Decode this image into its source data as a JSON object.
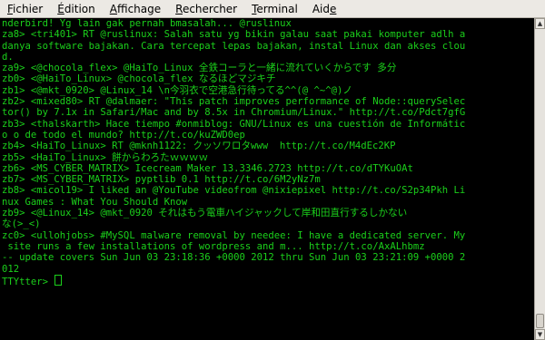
{
  "menu": [
    {
      "mn": "F",
      "rest": "ichier"
    },
    {
      "mn": "É",
      "rest": "dition"
    },
    {
      "mn": "A",
      "rest": "ffichage"
    },
    {
      "mn": "R",
      "rest": "echercher"
    },
    {
      "mn": "T",
      "rest": "erminal"
    },
    {
      "mn": "",
      "pre": "Aid",
      "mn2": "e"
    }
  ],
  "terminal": {
    "lines": [
      "nderbird! Yg lain gak pernah bmasalah... @ruslinux",
      "za8> <tri401> RT @ruslinux: Salah satu yg bikin galau saat pakai komputer adlh a",
      "danya software bajakan. Cara tercepat lepas bajakan, instal Linux dan akses clou",
      "d.",
      "za9> <@chocola_flex> @HaiTo_Linux 全鉄コーラと一緒に流れていくからです 多分",
      "zb0> <@HaiTo_Linux> @chocola_flex なるほどマジキチ",
      "zb1> <@mkt_0920> @Linux_14 \\n今羽衣で空港急行待ってる^^(@ ^~^@)ノ",
      "zb2> <mixed80> RT @dalmaer: \"This patch improves performance of Node::querySelec",
      "tor() by 7.1x in Safari/Mac and by 8.5x in Chromium/Linux.\" http://t.co/Pdct7gfG",
      "zb3> <thalskarth> Hace tiempo #onmiblog: GNU/Linux es una cuestión de Informátic",
      "o o de todo el mundo? http://t.co/kuZWD0ep",
      "zb4> <HaiTo_Linux> RT @mknh1122: クッソワロタwww  http://t.co/M4dEc2KP",
      "zb5> <HaiTo_Linux> 餅からわろたｗｗｗｗ",
      "zb6> <MS_CYBER_MATRIX> Icecream Maker 13.3346.2723 http://t.co/dTYKuOAt",
      "zb7> <MS_CYBER_MATRIX> pyptlib 0.1 http://t.co/6M2yNz7m",
      "zb8> <micol19> I liked an @YouTube videofrom @nixiepixel http://t.co/S2p34Pkh Li",
      "nux Games : What You Should Know",
      "zb9> <@Linux_14> @mkt_0920 それはもう電車ハイジャックして岸和田直行するしかない",
      "な(>_<)",
      "zc0> <ullohjobs> #MySQL malware removal by needee: I have a dedicated server. My",
      " site runs a few installations of wordpress and m... http://t.co/AxALhbmz",
      "-- update covers Sun Jun 03 23:18:36 +0000 2012 thru Sun Jun 03 23:21:09 +0000 2",
      "012",
      "TTYtter> "
    ]
  },
  "colors": {
    "terminal_bg": "#000000",
    "terminal_fg": "#1bd01b",
    "menubar_bg": "#ece9e4"
  },
  "icons": {
    "scroll_up": "▲",
    "scroll_down": "▼"
  }
}
